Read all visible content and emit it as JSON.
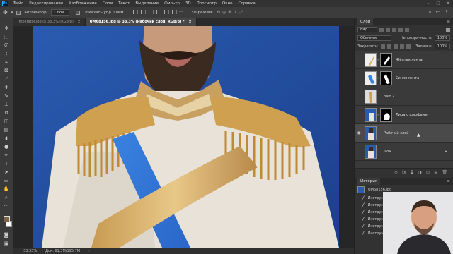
{
  "menubar": {
    "logo": "Ps",
    "items": [
      "Файл",
      "Редактирование",
      "Изображение",
      "Слои",
      "Текст",
      "Выделение",
      "Фильтр",
      "3D",
      "Просмотр",
      "Окно",
      "Справка"
    ],
    "min": "–",
    "max": "□",
    "close": "✕"
  },
  "options": {
    "autoselect_label": "Автовыбор:",
    "autoselect_value": "Слой",
    "show_controls_label": "Показать упр. элем.",
    "mode_3d_label": "3D-режим:"
  },
  "tabs": [
    {
      "label": "Imperator.jpg @ 33,3% (RGB/8)",
      "close": "×"
    },
    {
      "label": "UM68156.jpg @ 33,3% (Рабочий слой, RGB/8) *",
      "close": "×"
    }
  ],
  "status": {
    "zoom": "33,33%",
    "doc": "Док: 61,3M/195,7M"
  },
  "layers_panel": {
    "title": "Слои",
    "filter_kind": "Вид",
    "blend_mode": "Обычные",
    "opacity_label": "Непрозрачность:",
    "opacity_value": "100%",
    "lock_label": "Закрепить:",
    "fill_label": "Заливка:",
    "fill_value": "100%",
    "layers": [
      {
        "name": "Жёлтая лента",
        "visible": false,
        "has_mask": true,
        "selected": false
      },
      {
        "name": "Синяя лента",
        "visible": false,
        "has_mask": true,
        "selected": false
      },
      {
        "name": "part 2",
        "visible": false,
        "has_mask": false,
        "selected": false
      },
      {
        "name": "Лица с шарфами",
        "visible": false,
        "has_mask": true,
        "selected": false
      },
      {
        "name": "Рабочий слой",
        "visible": true,
        "has_mask": false,
        "selected": true
      },
      {
        "name": "Фон",
        "visible": false,
        "has_mask": false,
        "selected": false,
        "locked": true
      }
    ]
  },
  "history_panel": {
    "title": "История",
    "snapshot": "UM68156.jpg",
    "items": [
      "Инструмент",
      "Инструмент",
      "Инструмент",
      "Инструмент",
      "Инструмент",
      "Инструмент"
    ]
  },
  "colors": {
    "foreground": "#7a6545",
    "background": "#ffffff",
    "accent": "#31a8ff"
  }
}
